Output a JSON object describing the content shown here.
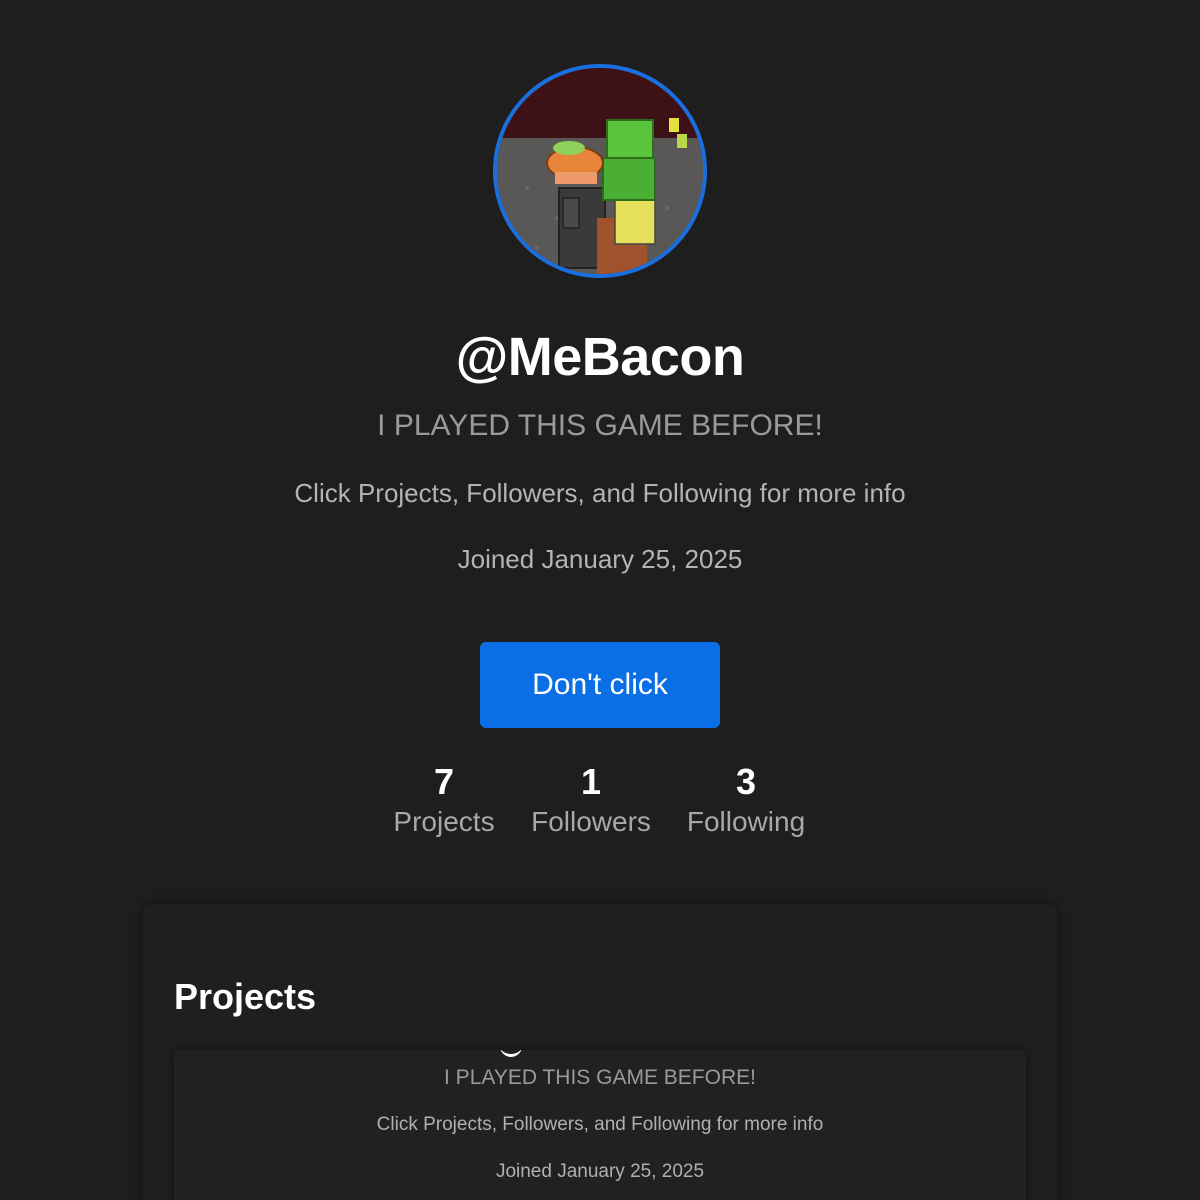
{
  "profile": {
    "avatar_icon": "roblox-character-avatar",
    "username": "@MeBacon",
    "tagline": "I PLAYED THIS GAME BEFORE!",
    "info": "Click Projects, Followers, and Following for more info",
    "joined": "Joined January 25, 2025"
  },
  "action_button": {
    "label": "Don't click",
    "color": "#0a6ee5"
  },
  "stats": {
    "projects": {
      "count": "7",
      "label": "Projects"
    },
    "followers": {
      "count": "1",
      "label": "Followers"
    },
    "following": {
      "count": "3",
      "label": "Following"
    }
  },
  "projects_section": {
    "title": "Projects",
    "preview": {
      "tagline": "I PLAYED THIS GAME BEFORE!",
      "info": "Click Projects, Followers, and Following for more info",
      "joined": "Joined January 25, 2025"
    }
  },
  "colors": {
    "background": "#1e1e1e",
    "accent": "#1a6fe0"
  }
}
